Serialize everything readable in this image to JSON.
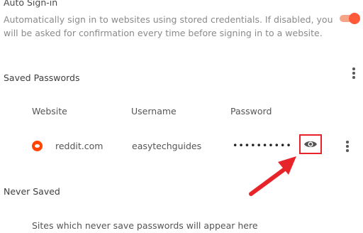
{
  "auto_signin": {
    "title": "Auto Sign-in",
    "description_line1": "Automatically sign in to websites using stored credentials. If disabled, you",
    "description_line2": "will be asked for confirmation every time before signing in to a website.",
    "enabled": true,
    "accent_color": "#ff5a3a"
  },
  "saved_passwords": {
    "title": "Saved Passwords",
    "columns": [
      "Website",
      "Username",
      "Password"
    ],
    "rows": [
      {
        "site": "reddit.com",
        "icon": "reddit-icon",
        "username": "easytechguides",
        "password": "••••••••••"
      }
    ]
  },
  "never_saved": {
    "title": "Never Saved",
    "empty_text": "Sites which never save passwords will appear here"
  },
  "annotation": {
    "highlight_color": "#e8242b"
  }
}
